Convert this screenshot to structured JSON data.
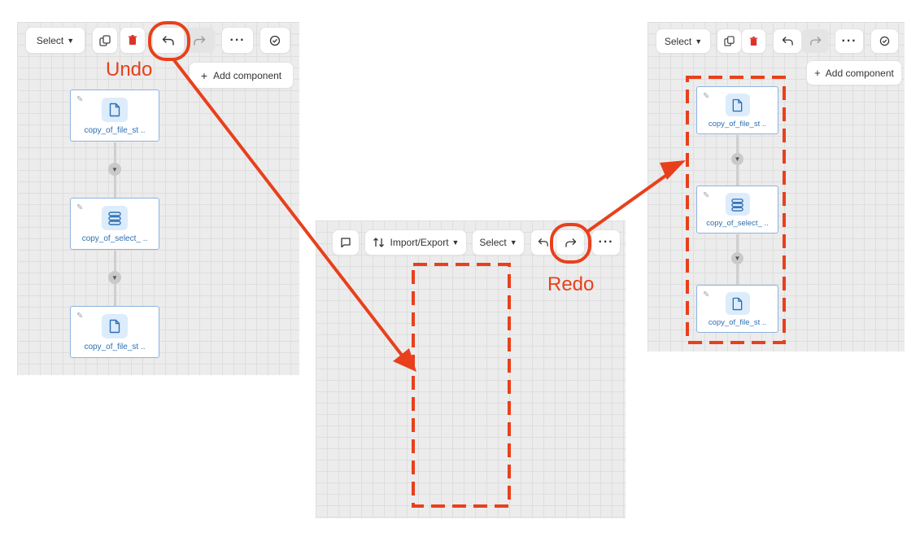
{
  "annotations": {
    "undo_label": "Undo",
    "redo_label": "Redo"
  },
  "left_panel": {
    "toolbar": {
      "select_label": "Select"
    },
    "add_component_label": "Add component",
    "nodes": [
      {
        "label": "copy_of_file_st ..",
        "icon": "file-icon"
      },
      {
        "label": "copy_of_select_ ..",
        "icon": "stack-icon"
      },
      {
        "label": "copy_of_file_st ..",
        "icon": "file-icon"
      }
    ]
  },
  "middle_panel": {
    "toolbar": {
      "import_export_label": "Import/Export",
      "select_label": "Select"
    }
  },
  "right_panel": {
    "toolbar": {
      "select_label": "Select"
    },
    "add_component_label": "Add component",
    "nodes": [
      {
        "label": "copy_of_file_st ..",
        "icon": "file-icon"
      },
      {
        "label": "copy_of_select_ ..",
        "icon": "stack-icon"
      },
      {
        "label": "copy_of_file_st ..",
        "icon": "file-icon"
      }
    ]
  },
  "colors": {
    "highlight": "#e8401c",
    "node_border": "#8fb3e0",
    "node_text": "#2c6fb4",
    "node_icon_bg": "#dcecfb",
    "delete_red": "#d9342b"
  }
}
